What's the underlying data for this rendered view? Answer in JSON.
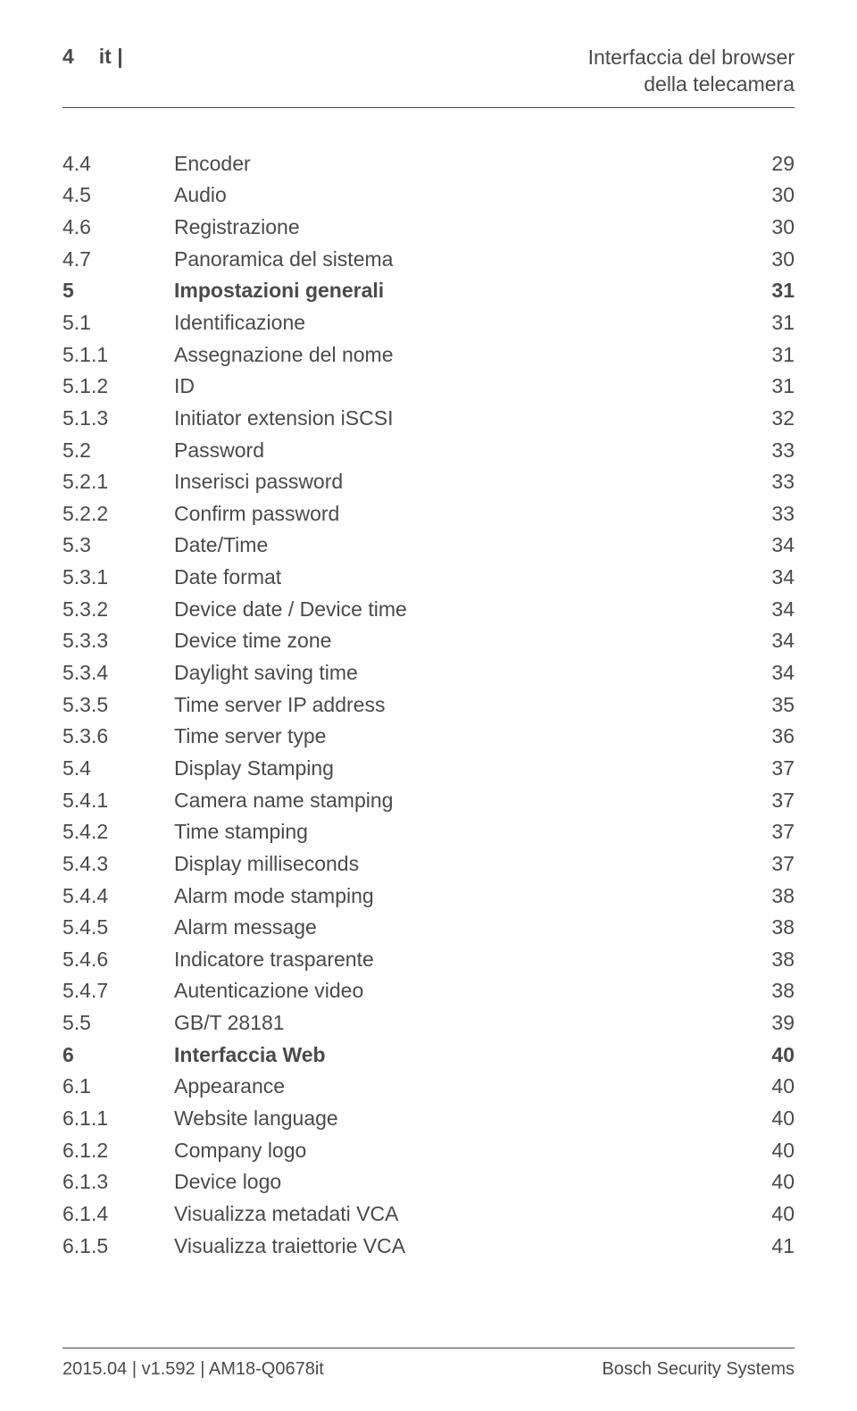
{
  "header": {
    "pageNumber": "4",
    "langCode": "it |",
    "titleLine1": "Interfaccia del browser",
    "titleLine2": "della telecamera"
  },
  "toc": [
    {
      "num": "4.4",
      "title": "Encoder",
      "page": "29",
      "bold": false
    },
    {
      "num": "4.5",
      "title": "Audio",
      "page": "30",
      "bold": false
    },
    {
      "num": "4.6",
      "title": "Registrazione",
      "page": "30",
      "bold": false
    },
    {
      "num": "4.7",
      "title": "Panoramica del sistema",
      "page": "30",
      "bold": false
    },
    {
      "num": "5",
      "title": "Impostazioni generali",
      "page": "31",
      "bold": true
    },
    {
      "num": "5.1",
      "title": "Identificazione",
      "page": "31",
      "bold": false
    },
    {
      "num": "5.1.1",
      "title": "Assegnazione del nome",
      "page": "31",
      "bold": false
    },
    {
      "num": "5.1.2",
      "title": "ID",
      "page": "31",
      "bold": false
    },
    {
      "num": "5.1.3",
      "title": "Initiator extension iSCSI",
      "page": "32",
      "bold": false
    },
    {
      "num": "5.2",
      "title": "Password",
      "page": "33",
      "bold": false
    },
    {
      "num": "5.2.1",
      "title": "Inserisci password",
      "page": "33",
      "bold": false
    },
    {
      "num": "5.2.2",
      "title": "Confirm password",
      "page": "33",
      "bold": false
    },
    {
      "num": "5.3",
      "title": "Date/Time",
      "page": "34",
      "bold": false
    },
    {
      "num": "5.3.1",
      "title": "Date format",
      "page": "34",
      "bold": false
    },
    {
      "num": "5.3.2",
      "title": "Device date / Device time",
      "page": "34",
      "bold": false
    },
    {
      "num": "5.3.3",
      "title": "Device time zone",
      "page": "34",
      "bold": false
    },
    {
      "num": "5.3.4",
      "title": "Daylight saving time",
      "page": "34",
      "bold": false
    },
    {
      "num": "5.3.5",
      "title": "Time server IP address",
      "page": "35",
      "bold": false
    },
    {
      "num": "5.3.6",
      "title": "Time server type",
      "page": "36",
      "bold": false
    },
    {
      "num": "5.4",
      "title": "Display Stamping",
      "page": "37",
      "bold": false
    },
    {
      "num": "5.4.1",
      "title": "Camera name stamping",
      "page": "37",
      "bold": false
    },
    {
      "num": "5.4.2",
      "title": "Time stamping",
      "page": "37",
      "bold": false
    },
    {
      "num": "5.4.3",
      "title": "Display milliseconds",
      "page": "37",
      "bold": false
    },
    {
      "num": "5.4.4",
      "title": "Alarm mode stamping",
      "page": "38",
      "bold": false
    },
    {
      "num": "5.4.5",
      "title": "Alarm message",
      "page": "38",
      "bold": false
    },
    {
      "num": "5.4.6",
      "title": "Indicatore trasparente",
      "page": "38",
      "bold": false
    },
    {
      "num": "5.4.7",
      "title": "Autenticazione video",
      "page": "38",
      "bold": false
    },
    {
      "num": "5.5",
      "title": "GB/T 28181",
      "page": "39",
      "bold": false
    },
    {
      "num": "6",
      "title": "Interfaccia Web",
      "page": "40",
      "bold": true
    },
    {
      "num": "6.1",
      "title": "Appearance",
      "page": "40",
      "bold": false
    },
    {
      "num": "6.1.1",
      "title": "Website language",
      "page": "40",
      "bold": false
    },
    {
      "num": "6.1.2",
      "title": "Company logo",
      "page": "40",
      "bold": false
    },
    {
      "num": "6.1.3",
      "title": "Device logo",
      "page": "40",
      "bold": false
    },
    {
      "num": "6.1.4",
      "title": "Visualizza metadati VCA",
      "page": "40",
      "bold": false
    },
    {
      "num": "6.1.5",
      "title": "Visualizza traiettorie VCA",
      "page": "41",
      "bold": false
    }
  ],
  "footer": {
    "left": "2015.04 | v1.592 | AM18-Q0678it",
    "right": "Bosch Security Systems"
  }
}
